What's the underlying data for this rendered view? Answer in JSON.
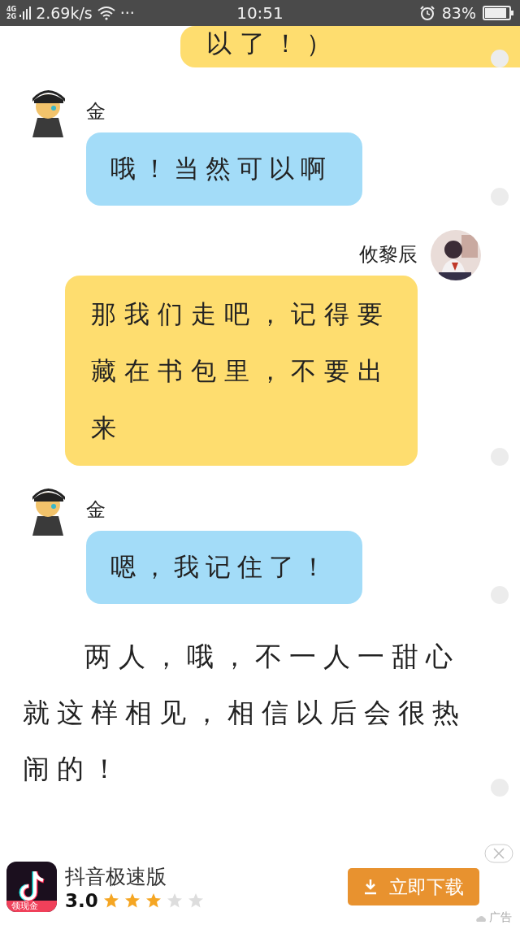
{
  "status_bar": {
    "network_top": "4G",
    "network_bottom": "2G",
    "speed": "2.69k/s",
    "more": "···",
    "time": "10:51",
    "battery_percent": "83%"
  },
  "messages": [
    {
      "kind": "outgoing",
      "text": "以了！）"
    },
    {
      "kind": "incoming",
      "sender": "金",
      "text": "哦！当然可以啊"
    },
    {
      "kind": "outgoing",
      "sender": "攸黎辰",
      "text": "那我们走吧，记得要藏在书包里，不要出来"
    },
    {
      "kind": "incoming",
      "sender": "金",
      "text": "嗯，我记住了！"
    }
  ],
  "narration": "两人，哦，不一人一甜心就这样相见，相信以后会很热闹的！",
  "ad": {
    "app_name": "抖音极速版",
    "icon_badge": "领现金",
    "rating": "3.0",
    "stars": 3,
    "button": "立即下载",
    "ad_label": "广告"
  }
}
